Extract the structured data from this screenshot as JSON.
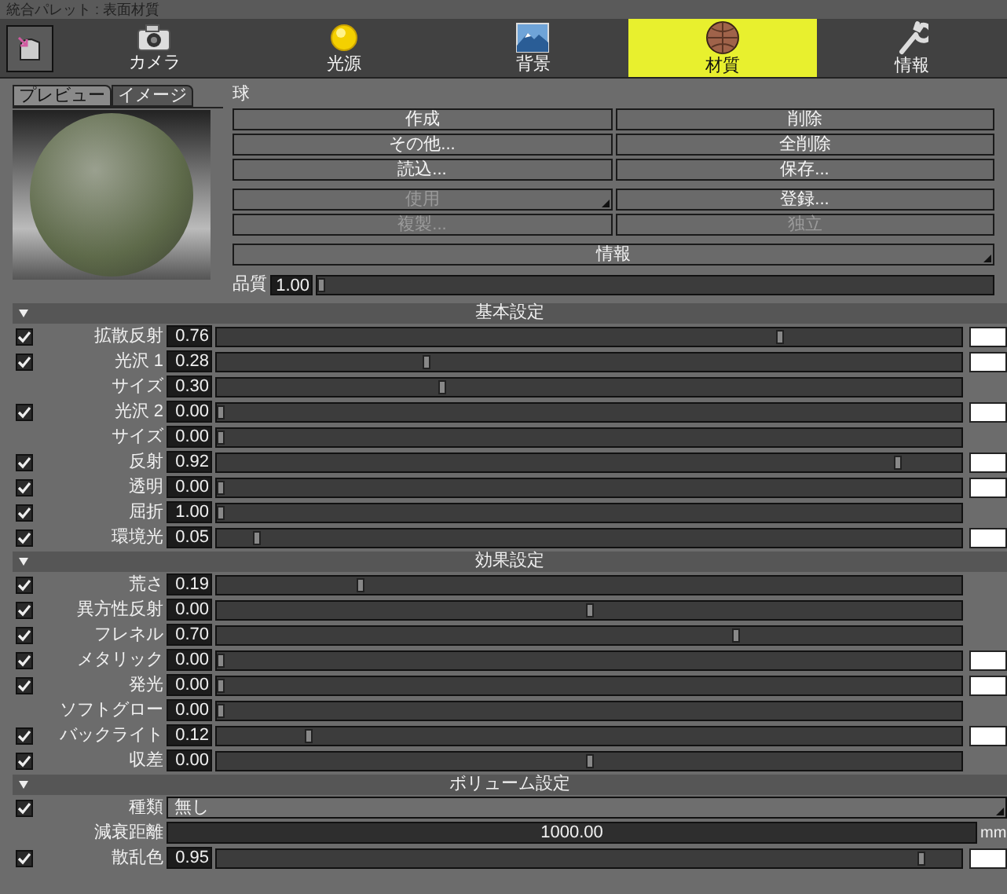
{
  "window": {
    "title": "統合パレット : 表面材質"
  },
  "toolbar": [
    {
      "label": "カメラ",
      "selected": false
    },
    {
      "label": "光源",
      "selected": false
    },
    {
      "label": "背景",
      "selected": false
    },
    {
      "label": "材質",
      "selected": true
    },
    {
      "label": "情報",
      "selected": false
    }
  ],
  "preview_tabs": [
    {
      "label": "プレビュー",
      "selected": true
    },
    {
      "label": "イメージ",
      "selected": false
    }
  ],
  "object_name": "球",
  "button_groups": [
    [
      {
        "label": "作成",
        "disabled": false,
        "dropdown": false
      },
      {
        "label": "削除",
        "disabled": false,
        "dropdown": false
      },
      {
        "label": "その他...",
        "disabled": false,
        "dropdown": false
      },
      {
        "label": "全削除",
        "disabled": false,
        "dropdown": false
      },
      {
        "label": "読込...",
        "disabled": false,
        "dropdown": false
      },
      {
        "label": "保存...",
        "disabled": false,
        "dropdown": false
      }
    ],
    [
      {
        "label": "使用",
        "disabled": true,
        "dropdown": true
      },
      {
        "label": "登録...",
        "disabled": false,
        "dropdown": false
      },
      {
        "label": "複製...",
        "disabled": true,
        "dropdown": false
      },
      {
        "label": "独立",
        "disabled": true,
        "dropdown": false
      }
    ]
  ],
  "info_button": {
    "label": "情報",
    "dropdown": true
  },
  "quality": {
    "label": "品質",
    "value": "1.00",
    "level": 0
  },
  "sections": [
    {
      "title": "基本設定",
      "expanded": true,
      "rows": [
        {
          "kind": "slider",
          "checked": true,
          "label": "拡散反射",
          "value": "0.76",
          "level": 0.76,
          "swatch": true
        },
        {
          "kind": "slider",
          "checked": true,
          "label": "光沢 1",
          "value": "0.28",
          "level": 0.28,
          "swatch": true
        },
        {
          "kind": "slider",
          "label": "サイズ",
          "value": "0.30",
          "level": 0.3,
          "swatch": false
        },
        {
          "kind": "slider",
          "checked": true,
          "label": "光沢 2",
          "value": "0.00",
          "level": 0,
          "swatch": true
        },
        {
          "kind": "slider",
          "label": "サイズ",
          "value": "0.00",
          "level": 0,
          "swatch": false
        },
        {
          "kind": "slider",
          "checked": true,
          "label": "反射",
          "value": "0.92",
          "level": 0.92,
          "swatch": true
        },
        {
          "kind": "slider",
          "checked": true,
          "label": "透明",
          "value": "0.00",
          "level": 0,
          "swatch": true
        },
        {
          "kind": "slider",
          "checked": true,
          "label": "屈折",
          "value": "1.00",
          "level": 0,
          "swatch": false
        },
        {
          "kind": "slider",
          "checked": true,
          "label": "環境光",
          "value": "0.05",
          "level": 0.05,
          "swatch": true
        }
      ]
    },
    {
      "title": "効果設定",
      "expanded": true,
      "rows": [
        {
          "kind": "slider",
          "checked": true,
          "label": "荒さ",
          "value": "0.19",
          "level": 0.19,
          "swatch": false
        },
        {
          "kind": "slider",
          "checked": true,
          "label": "異方性反射",
          "value": "0.00",
          "level": 0.5,
          "swatch": false
        },
        {
          "kind": "slider",
          "checked": true,
          "label": "フレネル",
          "value": "0.70",
          "level": 0.7,
          "swatch": false
        },
        {
          "kind": "slider",
          "checked": true,
          "label": "メタリック",
          "value": "0.00",
          "level": 0,
          "swatch": true
        },
        {
          "kind": "slider",
          "checked": true,
          "label": "発光",
          "value": "0.00",
          "level": 0,
          "swatch": true
        },
        {
          "kind": "slider",
          "label": "ソフトグロー",
          "value": "0.00",
          "level": 0,
          "swatch": false
        },
        {
          "kind": "slider",
          "checked": true,
          "label": "バックライト",
          "value": "0.12",
          "level": 0.12,
          "swatch": true
        },
        {
          "kind": "slider",
          "checked": true,
          "label": "収差",
          "value": "0.00",
          "level": 0.5,
          "swatch": false
        }
      ]
    },
    {
      "title": "ボリューム設定",
      "expanded": true,
      "rows": [
        {
          "kind": "select",
          "checked": true,
          "label": "種類",
          "value": "無し"
        },
        {
          "kind": "number",
          "label": "減衰距離",
          "value": "1000.00",
          "unit": "mm"
        },
        {
          "kind": "slider",
          "checked": true,
          "label": "散乱色",
          "value": "0.95",
          "level": 0.95,
          "swatch": true
        }
      ]
    }
  ]
}
